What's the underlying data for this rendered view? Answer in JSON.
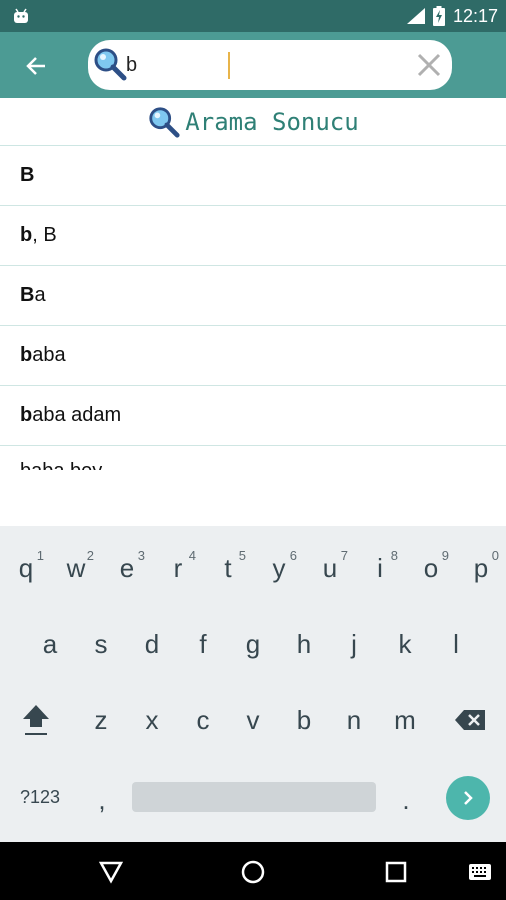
{
  "status_bar": {
    "time": "12:17",
    "icons": [
      "android-icon",
      "signal-icon",
      "battery-charging-icon"
    ]
  },
  "app_bar": {
    "back_icon": "arrow-left-icon",
    "search": {
      "value": "b",
      "icon": "magnifier-icon",
      "clear_icon": "close-icon"
    }
  },
  "results_header": {
    "title": "Arama Sonucu",
    "icon": "magnifier-icon"
  },
  "results": [
    {
      "match": "B",
      "rest": ""
    },
    {
      "match": "b",
      "rest": ", B"
    },
    {
      "match": "B",
      "rest": "a"
    },
    {
      "match": "b",
      "rest": "aba"
    },
    {
      "match": "b",
      "rest": "aba adam"
    }
  ],
  "partial_result": "baba bey",
  "keyboard": {
    "row1": [
      {
        "key": "q",
        "hint": "1"
      },
      {
        "key": "w",
        "hint": "2"
      },
      {
        "key": "e",
        "hint": "3"
      },
      {
        "key": "r",
        "hint": "4"
      },
      {
        "key": "t",
        "hint": "5"
      },
      {
        "key": "y",
        "hint": "6"
      },
      {
        "key": "u",
        "hint": "7"
      },
      {
        "key": "i",
        "hint": "8"
      },
      {
        "key": "o",
        "hint": "9"
      },
      {
        "key": "p",
        "hint": "0"
      }
    ],
    "row2": [
      "a",
      "s",
      "d",
      "f",
      "g",
      "h",
      "j",
      "k",
      "l"
    ],
    "row3": [
      "z",
      "x",
      "c",
      "v",
      "b",
      "n",
      "m"
    ],
    "symbols_label": "?123",
    "comma": ",",
    "period": ".",
    "shift_icon": "shift-icon",
    "backspace_icon": "backspace-icon",
    "enter_icon": "chevron-right-icon"
  },
  "nav_bar": {
    "icons": [
      "back-triangle-icon",
      "home-circle-icon",
      "recents-square-icon",
      "keyboard-icon"
    ]
  },
  "colors": {
    "status_bar": "#2f6b67",
    "app_bar": "#4c9b94",
    "accent": "#4db6ac",
    "title": "#2f8076"
  }
}
